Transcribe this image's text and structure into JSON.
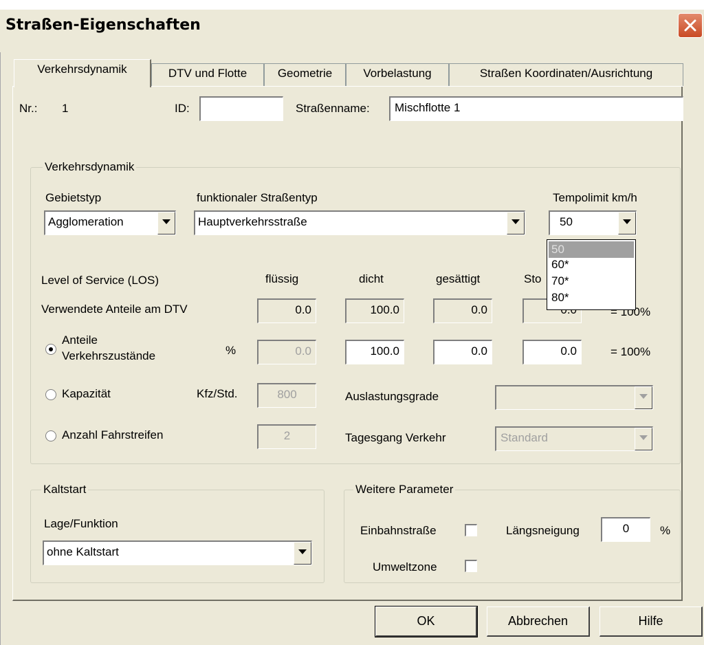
{
  "window": {
    "title": "Straßen-Eigenschaften"
  },
  "tabs": [
    {
      "label": "Verkehrsdynamik",
      "active": true
    },
    {
      "label": "DTV und Flotte",
      "active": false
    },
    {
      "label": "Geometrie",
      "active": false
    },
    {
      "label": "Vorbelastung",
      "active": false
    },
    {
      "label": "Straßen Koordinaten/Ausrichtung",
      "active": false
    }
  ],
  "header": {
    "nr_label": "Nr.:",
    "nr_value": "1",
    "id_label": "ID:",
    "id_value": "",
    "strassenname_label": "Straßenname:",
    "strassenname_value": "Mischflotte 1"
  },
  "verkehrsdynamik": {
    "group_title": "Verkehrsdynamik",
    "gebietstyp_label": "Gebietstyp",
    "gebietstyp_value": "Agglomeration",
    "strassentyp_label": "funktionaler Straßentyp",
    "strassentyp_value": "Hauptverkehrsstraße",
    "tempolimit_label": "Tempolimit km/h",
    "tempolimit_value": "50",
    "tempolimit_options": [
      "50",
      "60*",
      "70*",
      "80*"
    ],
    "tempolimit_selected_index": 0,
    "los_label": "Level of Service (LOS)",
    "los_columns": [
      "flüssig",
      "dicht",
      "gesättigt",
      "Sto"
    ],
    "anteile_dtv_label": "Verwendete Anteile am DTV",
    "anteile_dtv_values": [
      "0.0",
      "100.0",
      "0.0",
      "0.0"
    ],
    "anteile_dtv_sum": "= 100%",
    "radio_anteile_label_1": "Anteile",
    "radio_anteile_label_2": "Verkehrszustände",
    "radio_anteile_unit": "%",
    "radio_anteile_selected": true,
    "anteile_values": [
      "0.0",
      "100.0",
      "0.0",
      "0.0"
    ],
    "anteile_sum": "= 100%",
    "kapazitaet_label": "Kapazität",
    "kapazitaet_unit": "Kfz/Std.",
    "kapazitaet_value": "800",
    "auslastungsgrade_label": "Auslastungsgrade",
    "auslastungsgrade_value": "",
    "fahrstreifen_label": "Anzahl Fahrstreifen",
    "fahrstreifen_value": "2",
    "tagesgang_label": "Tagesgang Verkehr",
    "tagesgang_value": "Standard"
  },
  "kaltstart": {
    "group_title": "Kaltstart",
    "lage_label": "Lage/Funktion",
    "lage_value": "ohne Kaltstart"
  },
  "weitere": {
    "group_title": "Weitere Parameter",
    "einbahn_label": "Einbahnstraße",
    "einbahn_checked": false,
    "laengsneigung_label": "Längsneigung",
    "laengsneigung_value": "0",
    "laengsneigung_unit": "%",
    "umweltzone_label": "Umweltzone",
    "umweltzone_checked": false
  },
  "buttons": {
    "ok": "OK",
    "abbrechen": "Abbrechen",
    "hilfe": "Hilfe"
  }
}
